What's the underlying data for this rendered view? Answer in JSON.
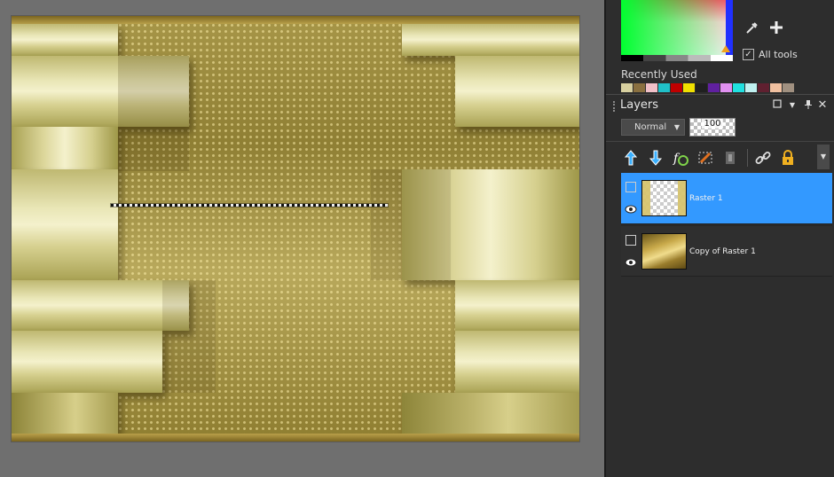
{
  "color_palette": {
    "tools_label": "All tools",
    "eyedropper_icon": "eyedropper-icon",
    "add_icon": "plus-icon"
  },
  "recently_used": {
    "title": "Recently Used",
    "swatches": [
      "#d8d0a0",
      "#8a7040",
      "#f0c0c8",
      "#20c0c8",
      "#c00000",
      "#f0e000",
      "#202020",
      "#6020a0",
      "#e090f0",
      "#20e0e0",
      "#c0f0f0",
      "#602030",
      "#f0c0a0",
      "#a09080"
    ]
  },
  "layers_panel": {
    "title": "Layers",
    "blend_mode": "Normal",
    "opacity": "100",
    "layers": [
      {
        "name": "Raster 1",
        "selected": true
      },
      {
        "name": "Copy of Raster 1",
        "selected": false
      }
    ],
    "toolbar_icons": [
      "move-layer-up-icon",
      "move-layer-down-icon",
      "layer-effects-icon",
      "delete-layer-icon",
      "layer-mask-icon",
      "link-icon",
      "lock-icon"
    ]
  },
  "colors": {
    "selection_highlight": "#3399ff",
    "panel_bg": "#2d2d2d",
    "workspace_bg": "#6f6f6f"
  }
}
